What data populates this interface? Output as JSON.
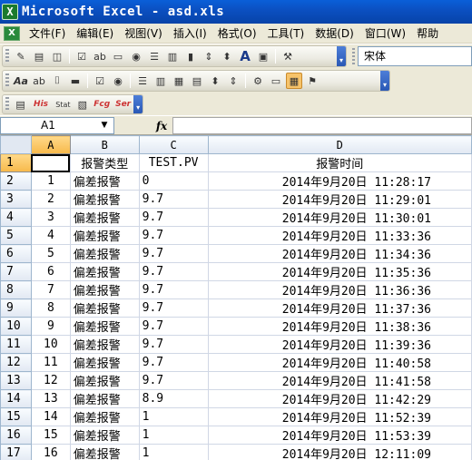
{
  "window": {
    "title": "Microsoft Excel - asd.xls",
    "app_icon": "excel-icon"
  },
  "menubar": {
    "items": [
      "文件(F)",
      "编辑(E)",
      "视图(V)",
      "插入(I)",
      "格式(O)",
      "工具(T)",
      "数据(D)",
      "窗口(W)",
      "帮助"
    ]
  },
  "toolbar": {
    "font_name": "宋体"
  },
  "formula_bar": {
    "cell_ref": "A1",
    "fx_label": "fx",
    "formula": ""
  },
  "grid": {
    "columns": [
      "A",
      "B",
      "C",
      "D"
    ],
    "header_row": {
      "row": "1",
      "a": "",
      "b": "报警类型",
      "c": "TEST.PV",
      "d": "报警时间"
    },
    "rows": [
      {
        "row": "2",
        "a": "1",
        "b": "偏差报警",
        "c": "0",
        "d": "2014年9月20日 11:28:17"
      },
      {
        "row": "3",
        "a": "2",
        "b": "偏差报警",
        "c": "9.7",
        "d": "2014年9月20日 11:29:01"
      },
      {
        "row": "4",
        "a": "3",
        "b": "偏差报警",
        "c": "9.7",
        "d": "2014年9月20日 11:30:01"
      },
      {
        "row": "5",
        "a": "4",
        "b": "偏差报警",
        "c": "9.7",
        "d": "2014年9月20日 11:33:36"
      },
      {
        "row": "6",
        "a": "5",
        "b": "偏差报警",
        "c": "9.7",
        "d": "2014年9月20日 11:34:36"
      },
      {
        "row": "7",
        "a": "6",
        "b": "偏差报警",
        "c": "9.7",
        "d": "2014年9月20日 11:35:36"
      },
      {
        "row": "8",
        "a": "7",
        "b": "偏差报警",
        "c": "9.7",
        "d": "2014年9月20日 11:36:36"
      },
      {
        "row": "9",
        "a": "8",
        "b": "偏差报警",
        "c": "9.7",
        "d": "2014年9月20日 11:37:36"
      },
      {
        "row": "10",
        "a": "9",
        "b": "偏差报警",
        "c": "9.7",
        "d": "2014年9月20日 11:38:36"
      },
      {
        "row": "11",
        "a": "10",
        "b": "偏差报警",
        "c": "9.7",
        "d": "2014年9月20日 11:39:36"
      },
      {
        "row": "12",
        "a": "11",
        "b": "偏差报警",
        "c": "9.7",
        "d": "2014年9月20日 11:40:58"
      },
      {
        "row": "13",
        "a": "12",
        "b": "偏差报警",
        "c": "9.7",
        "d": "2014年9月20日 11:41:58"
      },
      {
        "row": "14",
        "a": "13",
        "b": "偏差报警",
        "c": "8.9",
        "d": "2014年9月20日 11:42:29"
      },
      {
        "row": "15",
        "a": "14",
        "b": "偏差报警",
        "c": "1",
        "d": "2014年9月20日 11:52:39"
      },
      {
        "row": "16",
        "a": "15",
        "b": "偏差报警",
        "c": "1",
        "d": "2014年9月20日 11:53:39"
      },
      {
        "row": "17",
        "a": "16",
        "b": "偏差报警",
        "c": "1",
        "d": "2014年9月20日 12:11:09"
      }
    ]
  },
  "colors": {
    "titlebar": "#0b4fc0",
    "chrome": "#ece9d8",
    "active_header": "#f7b94a",
    "gridline": "#d0d7e5"
  }
}
